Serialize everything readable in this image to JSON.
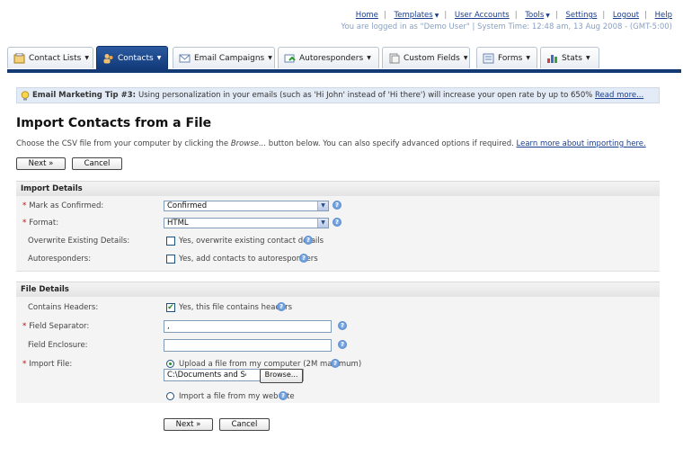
{
  "topnav": {
    "links": [
      {
        "label": "Home",
        "caret": false
      },
      {
        "label": "Templates",
        "caret": true
      },
      {
        "label": "User Accounts",
        "caret": false
      },
      {
        "label": "Tools",
        "caret": true
      },
      {
        "label": "Settings",
        "caret": false
      },
      {
        "label": "Logout",
        "caret": false
      },
      {
        "label": "Help",
        "caret": false
      }
    ],
    "status": "You are logged in as \"Demo User\" | System Time: 12:48 am, 13 Aug 2008 - (GMT-5:00)"
  },
  "tabs": [
    {
      "label": "Contact Lists",
      "icon": "contact-lists-icon",
      "active": false
    },
    {
      "label": "Contacts",
      "icon": "contacts-icon",
      "active": true
    },
    {
      "label": "Email Campaigns",
      "icon": "envelope-icon",
      "active": false
    },
    {
      "label": "Autoresponders",
      "icon": "autoresponder-icon",
      "active": false
    },
    {
      "label": "Custom Fields",
      "icon": "custom-fields-icon",
      "active": false
    },
    {
      "label": "Forms",
      "icon": "forms-icon",
      "active": false
    },
    {
      "label": "Stats",
      "icon": "stats-icon",
      "active": false
    }
  ],
  "tip": {
    "title": "Email Marketing Tip #3:",
    "text": "Using personalization in your emails (such as 'Hi John' instead of 'Hi there') will increase your open rate by up to 650%",
    "link": "Read more..."
  },
  "page": {
    "title": "Import Contacts from a File",
    "intro_before": "Choose the CSV file from your computer by clicking the ",
    "intro_em": "Browse...",
    "intro_after": " button below. You can also specify advanced options if required. ",
    "intro_link": "Learn more about importing here."
  },
  "buttons": {
    "next": "Next »",
    "cancel": "Cancel"
  },
  "import_details": {
    "heading": "Import Details",
    "mark_label": "Mark as Confirmed:",
    "mark_value": "Confirmed",
    "format_label": "Format:",
    "format_value": "HTML",
    "overwrite_label": "Overwrite Existing Details:",
    "overwrite_text": "Yes, overwrite existing contact details",
    "autoresp_label": "Autoresponders:",
    "autoresp_text": "Yes, add contacts to autoresponders"
  },
  "file_details": {
    "heading": "File Details",
    "headers_label": "Contains Headers:",
    "headers_text": "Yes, this file contains headers",
    "sep_label": "Field Separator:",
    "sep_value": ",",
    "enc_label": "Field Enclosure:",
    "enc_value": "",
    "file_label": "Import File:",
    "upload_text": "Upload a file from my computer (2M maximum)",
    "file_path": "C:\\Documents and Setti",
    "browse": "Browse...",
    "website_text": "Import a file from my web site"
  },
  "colors": {
    "accent": "#133a74",
    "tip_bg": "#e3ebf6",
    "link": "#1a3d8f"
  }
}
